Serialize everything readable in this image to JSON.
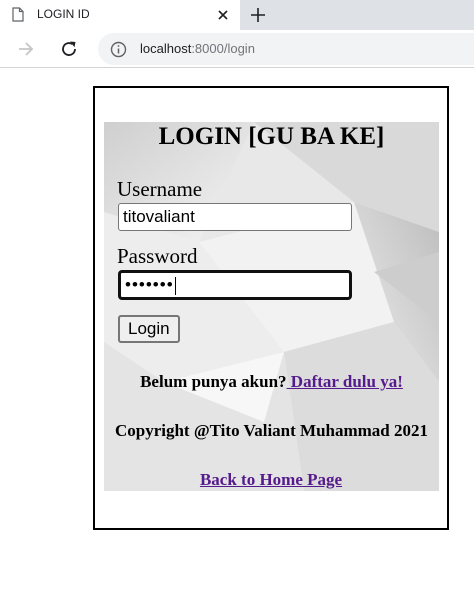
{
  "browser": {
    "tab_title": "LOGIN ID",
    "url_host": "localhost",
    "url_rest": ":8000/login"
  },
  "login": {
    "title": "LOGIN [GU BA KE]",
    "username_label": "Username",
    "username_value": "titovaliant",
    "password_label": "Password",
    "password_masked": "•••••••",
    "login_button": "Login",
    "register_prompt": "Belum punya akun?",
    "register_link": " Daftar dulu ya!",
    "copyright": "Copyright @Tito Valiant Muhammad 2021"
  },
  "footer": {
    "back_link": "Back to Home Page"
  },
  "icons": {
    "tab": "page-icon",
    "close": "close-icon",
    "new_tab": "plus-icon",
    "forward": "arrow-right-icon",
    "reload": "reload-icon",
    "info": "info-icon"
  },
  "colors": {
    "link": "#551a8b",
    "tabbar": "#dee1e6",
    "omnibox": "#f1f3f4"
  }
}
